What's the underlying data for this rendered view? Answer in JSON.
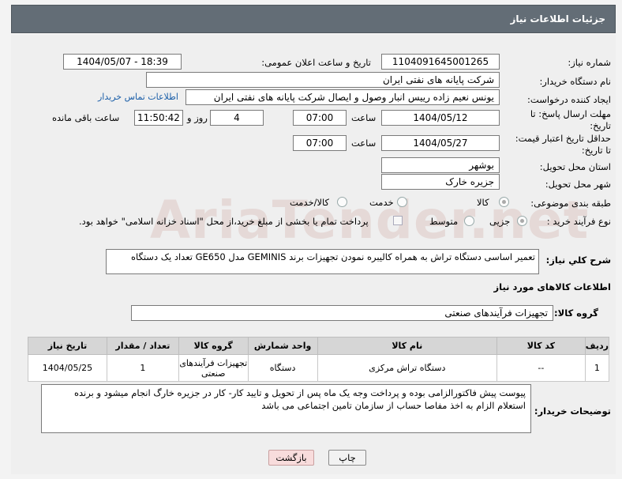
{
  "header": {
    "title": "جزئیات اطلاعات نیاز"
  },
  "watermark": "AriaTender.net",
  "fields": {
    "need_number_label": "شماره نیاز:",
    "need_number": "1104091645001265",
    "announce_label": "تاریخ و ساعت اعلان عمومی:",
    "announce_value": "1404/05/07 - 18:39",
    "buyer_org_label": "نام دستگاه خریدار:",
    "buyer_org": "شرکت پایانه های نفتی ایران",
    "requester_label": "ایجاد کننده درخواست:",
    "requester": "یونس نعیم زاده رییس انبار وصول و ایصال شرکت پایانه های نفتی ایران",
    "contact_link": "اطلاعات تماس خریدار",
    "deadline_label_1": "مهلت ارسال پاسخ: تا",
    "deadline_label_2": "تاریخ:",
    "deadline_date": "1404/05/12",
    "time_label": "ساعت",
    "deadline_time": "07:00",
    "days_value": "4",
    "days_label": "روز و",
    "remaining_time": "11:50:42",
    "remaining_label": "ساعت باقی مانده",
    "validity_label_1": "حداقل تاریخ اعتبار قیمت:",
    "validity_label_2": "تا تاریخ:",
    "validity_date": "1404/05/27",
    "validity_time": "07:00",
    "province_label": "استان محل تحویل:",
    "province": "بوشهر",
    "city_label": "شهر محل تحویل:",
    "city": "جزیره خارک",
    "category_label": "طبقه بندی موضوعی:",
    "category_options": [
      "کالا",
      "خدمت",
      "کالا/خدمت"
    ],
    "process_label": "نوع فرآیند خرید :",
    "process_options": [
      "جزیی",
      "متوسط"
    ],
    "payment_note": "پرداخت تمام یا بخشی از مبلغ خرید،از محل \"اسناد خزانه اسلامی\" خواهد بود.",
    "description_label": "شرح كلي نياز:",
    "description": "تعمیر اساسی دستگاه تراش به همراه کالیبره نمودن تجهیزات برند GEMINIS مدل GE650 تعداد یک دستگاه"
  },
  "goods": {
    "section_title": "اطلاعات کالاهای مورد نیاز",
    "group_label": "گروه کالا:",
    "group_value": "تجهیزات فرآیندهای صنعتی",
    "columns": [
      "ردیف",
      "کد کالا",
      "نام کالا",
      "واحد شمارش",
      "گروه کالا",
      "تعداد / مقدار",
      "تاریخ نیاز"
    ],
    "rows": [
      [
        "1",
        "--",
        "دستگاه تراش مرکزی",
        "دستگاه",
        "تجهیزات فرآیندهای صنعتی",
        "1",
        "1404/05/25"
      ]
    ]
  },
  "buyer_notes": {
    "label": "توضیحات خریدار:",
    "text": "پیوست پیش فاکتورالزامی بوده و پرداخت وجه یک ماه پس از تحویل و تایید کار- کار در جزیره خارگ انجام میشود و برنده استعلام الزام به اخذ مفاصا حساب از سازمان تامین اجتماعی می باشد"
  },
  "buttons": {
    "print": "چاپ",
    "back": "بازگشت"
  }
}
